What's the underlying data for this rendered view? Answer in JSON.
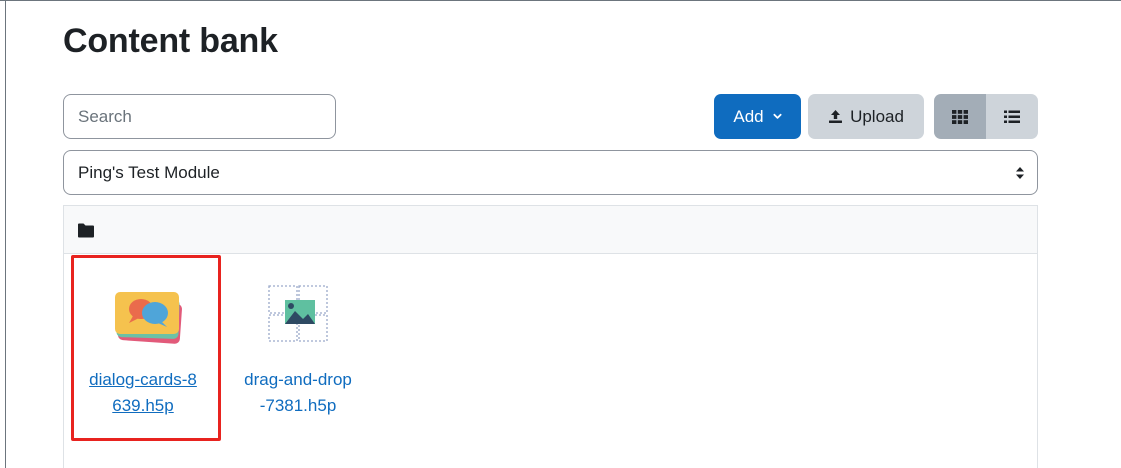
{
  "page": {
    "title": "Content bank"
  },
  "toolbar": {
    "search_placeholder": "Search",
    "add_label": "Add",
    "upload_label": "Upload",
    "view_grid_icon": "grid-view-icon",
    "view_list_icon": "list-view-icon"
  },
  "context": {
    "selected": "Ping's Test Module"
  },
  "breadcrumb": {
    "icon": "folder-icon"
  },
  "files": [
    {
      "name_line1": "dialog-cards-8",
      "name_line2": "639.h5p",
      "icon": "dialog-cards-icon",
      "highlighted": true
    },
    {
      "name_line1": "drag-and-drop",
      "name_line2": "-7381.h5p",
      "icon": "drag-and-drop-icon",
      "highlighted": false
    }
  ],
  "colors": {
    "primary": "#0f6cbf",
    "secondary": "#ced4da",
    "highlight": "#e8231f"
  }
}
